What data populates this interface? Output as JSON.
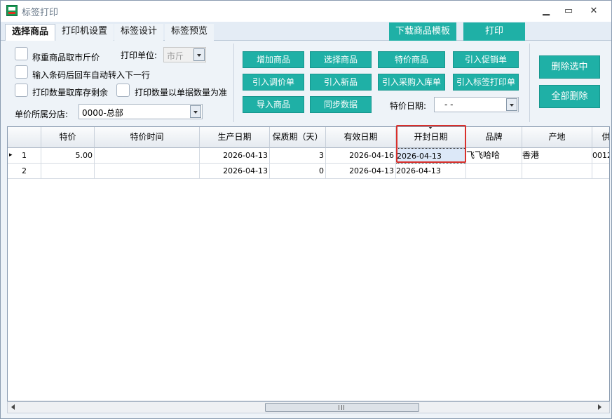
{
  "window": {
    "title": "标签打印",
    "minimize_glyph": "▁",
    "maximize_glyph": "▭",
    "close_glyph": "✕"
  },
  "tabs": [
    {
      "label": "选择商品",
      "active": true
    },
    {
      "label": "打印机设置"
    },
    {
      "label": "标签设计"
    },
    {
      "label": "标签预览"
    }
  ],
  "top_buttons": {
    "download_template": "下载商品模板",
    "print": "打印"
  },
  "options": {
    "weigh_jin": "称重商品取市斤价",
    "print_unit_label": "打印单位:",
    "print_unit_value": "市斤",
    "barcode_enter": "输入条码后回车自动转入下一行",
    "qty_stock": "打印数量取库存剩余",
    "qty_doc": "打印数量以单据数量为准",
    "branch_label": "单价所属分店:",
    "branch_value": "0000-总部"
  },
  "actions": {
    "add_product": "增加商品",
    "select_product": "选择商品",
    "special_product": "特价商品",
    "import_promo": "引入促销单",
    "import_price_adj": "引入调价单",
    "import_new": "引入新品",
    "import_purchase": "引入采购入库单",
    "import_label_print": "引入标签打印单",
    "import_products": "导入商品",
    "sync_data": "同步数据",
    "special_date_label": "特价日期:",
    "special_date_value": "-    -",
    "delete_selected": "删除选中",
    "delete_all": "全部删除"
  },
  "colors": {
    "accent": "#1fb0a6",
    "highlight_box": "#d9302b"
  },
  "grid": {
    "columns": [
      "特价",
      "特价时间",
      "生产日期",
      "保质期（天）",
      "有效日期",
      "开封日期",
      "品牌",
      "产地",
      "供"
    ],
    "rows": [
      {
        "num": "1",
        "special_price": "5.00",
        "special_time": "",
        "prod_date": "2026-04-13",
        "shelf_days": "3",
        "expiry": "2026-04-16",
        "open_date": "2026-04-13",
        "brand": "飞飞哈哈",
        "origin": "香港",
        "supplier": "0012"
      },
      {
        "num": "2",
        "special_price": "",
        "special_time": "",
        "prod_date": "2026-04-13",
        "shelf_days": "0",
        "expiry": "2026-04-13",
        "open_date": "2026-04-13",
        "brand": "",
        "origin": "",
        "supplier": ""
      }
    ],
    "current_row_marker": "▸"
  }
}
